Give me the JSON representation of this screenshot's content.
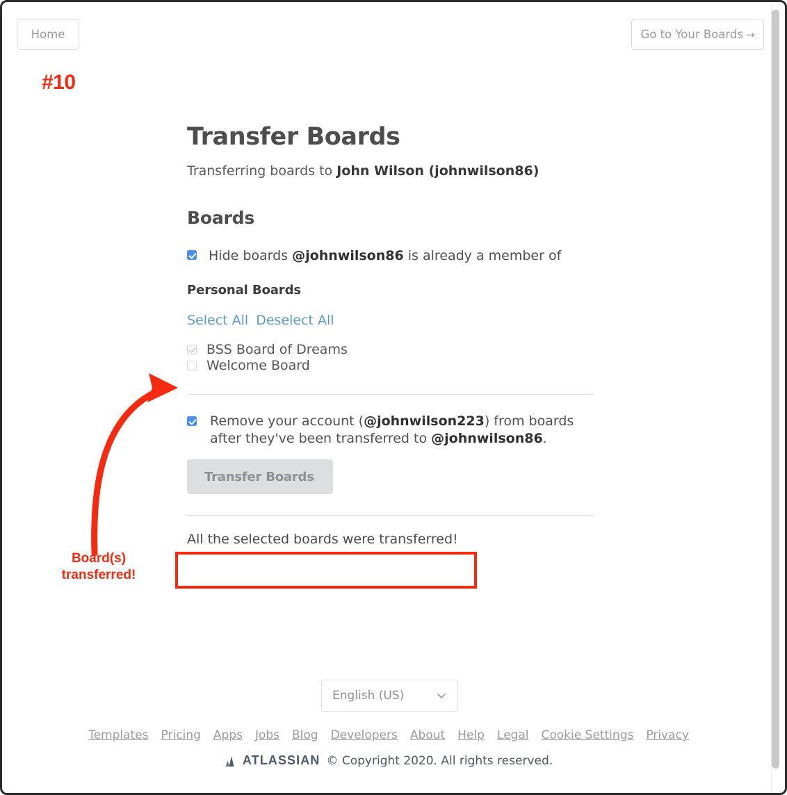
{
  "topbar": {
    "home_label": "Home",
    "go_boards_label": "Go to Your Boards",
    "go_boards_arrow": "→"
  },
  "annotations": {
    "number": "#10",
    "caption": "Board(s)\ntransferred!",
    "caption_line1": "Board(s)",
    "caption_line2": "transferred!",
    "color": "#f42b10"
  },
  "main": {
    "title": "Transfer Boards",
    "subtitle_prefix": "Transferring boards to ",
    "subtitle_target": "John Wilson (johnwilson86)",
    "boards_heading": "Boards",
    "hide_boards": {
      "checked": true,
      "text_prefix": "Hide boards ",
      "text_handle": "@johnwilson86",
      "text_suffix": " is already a member of"
    },
    "personal_boards_label": "Personal Boards",
    "select_all_label": "Select All",
    "deselect_all_label": "Deselect All",
    "boards": [
      {
        "name": "BSS Board of Dreams",
        "checked": true,
        "disabled": true
      },
      {
        "name": "Welcome Board",
        "checked": false,
        "disabled": true
      }
    ],
    "remove_account": {
      "checked": true,
      "part1": "Remove your account (",
      "handle1": "@johnwilson223",
      "part2": ") from boards after they've been transferred to ",
      "handle2": "@johnwilson86",
      "part3": "."
    },
    "transfer_button_label": "Transfer Boards",
    "transfer_button_disabled": true,
    "result_message": "All the selected boards were transferred!"
  },
  "footer": {
    "language_value": "English (US)",
    "chevron_icon": "chevron-down-icon",
    "links": [
      "Templates",
      "Pricing",
      "Apps",
      "Jobs",
      "Blog",
      "Developers",
      "About",
      "Help",
      "Legal",
      "Cookie Settings",
      "Privacy"
    ],
    "logo_text": "ATLASSIAN",
    "copyright": "© Copyright 2020. All rights reserved."
  },
  "colors": {
    "accent_blue": "#4a90f0",
    "link_blue": "#5f9bc4",
    "annotation_red": "#f42b10",
    "atlassian": "#4c5769"
  }
}
